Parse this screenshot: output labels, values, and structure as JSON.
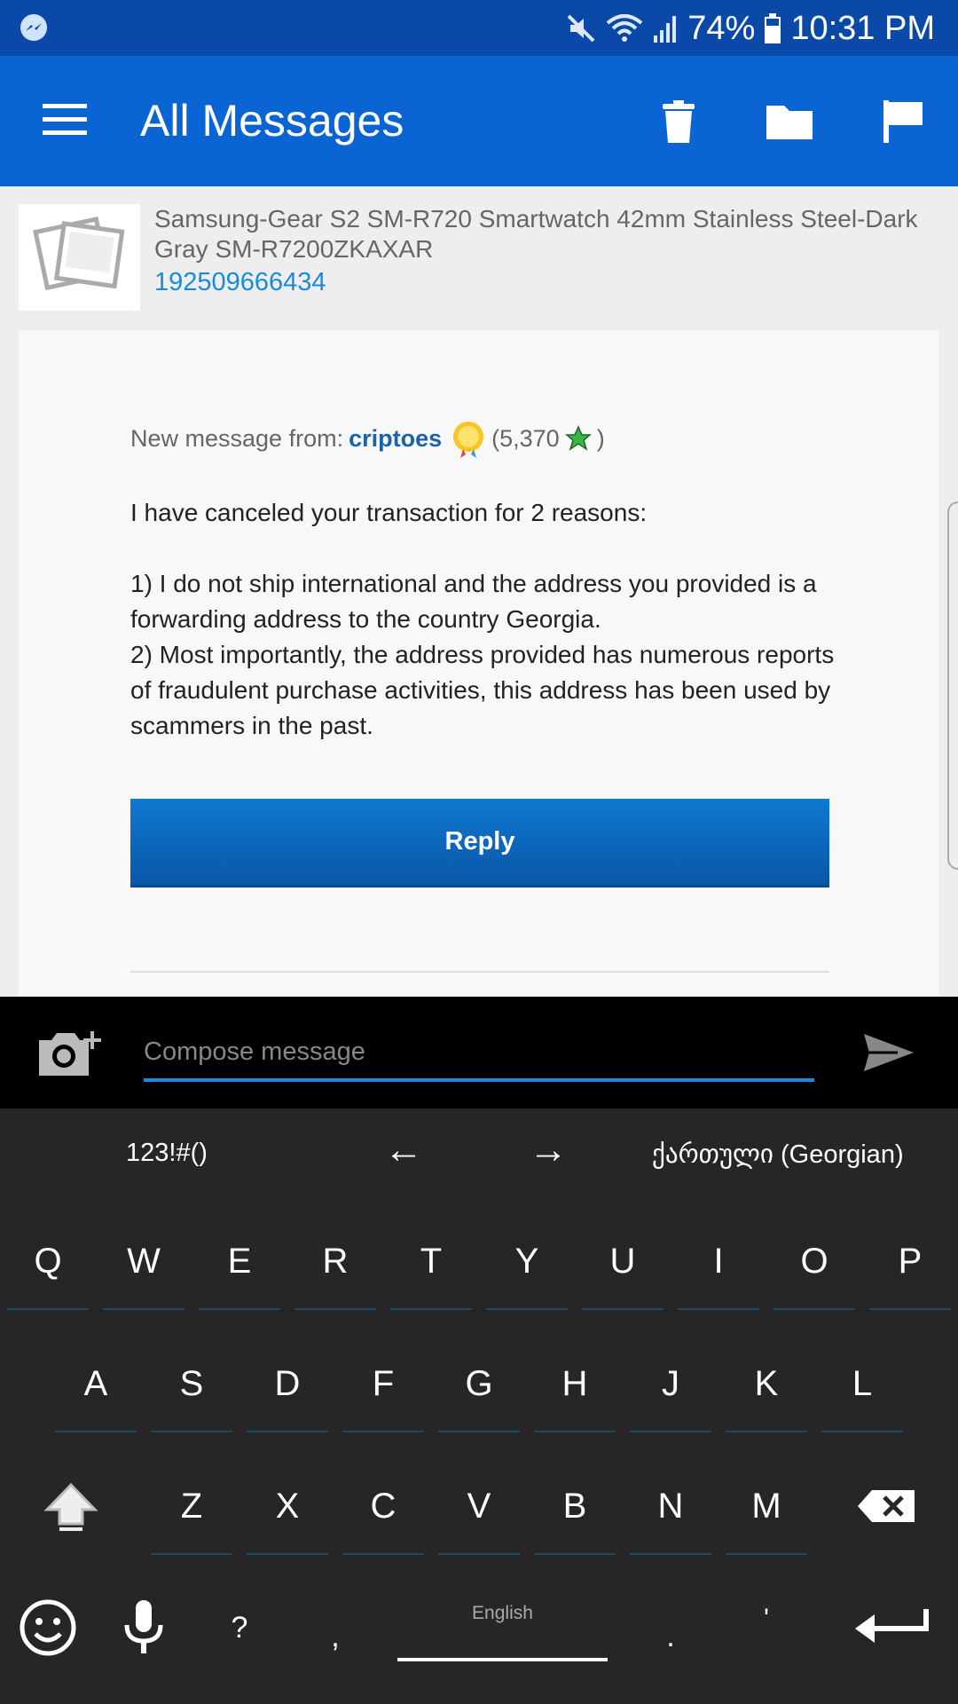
{
  "status_bar": {
    "battery": "74%",
    "time": "10:31 PM",
    "icons": [
      "messenger-icon",
      "mute-icon",
      "wifi-icon",
      "signal-icon",
      "battery-icon"
    ]
  },
  "app_bar": {
    "title": "All Messages",
    "actions": [
      "delete-icon",
      "folder-icon",
      "flag-icon"
    ]
  },
  "item": {
    "title": "Samsung-Gear S2 SM-R720 Smartwatch 42mm Stainless Steel-Dark Gray SM-R7200ZKAXAR",
    "number": "192509666434"
  },
  "message": {
    "from_label": "New message from:",
    "username": "criptoes",
    "score_prefix": "(5,370",
    "score_suffix": ")",
    "line1": "I have canceled your transaction for 2 reasons:",
    "line2": "1) I do not ship international and the address you provided is a forwarding address to the country Georgia.",
    "line3": "2) Most importantly, the address provided has numerous reports of fraudulent purchase activities, this address has been used by scammers in the past.",
    "reply_label": "Reply"
  },
  "compose": {
    "placeholder": "Compose message"
  },
  "keyboard": {
    "symbols": "123!#()",
    "left_arrow": "←",
    "right_arrow": "→",
    "language": "ქართული (Georgian)",
    "row1": [
      "Q",
      "W",
      "E",
      "R",
      "T",
      "Y",
      "U",
      "I",
      "O",
      "P"
    ],
    "row2": [
      "A",
      "S",
      "D",
      "F",
      "G",
      "H",
      "J",
      "K",
      "L"
    ],
    "row3": [
      "Z",
      "X",
      "C",
      "V",
      "B",
      "N",
      "M"
    ],
    "question": "?",
    "comma": ",",
    "space_label": "English",
    "period": ".",
    "apostrophe": "'"
  }
}
